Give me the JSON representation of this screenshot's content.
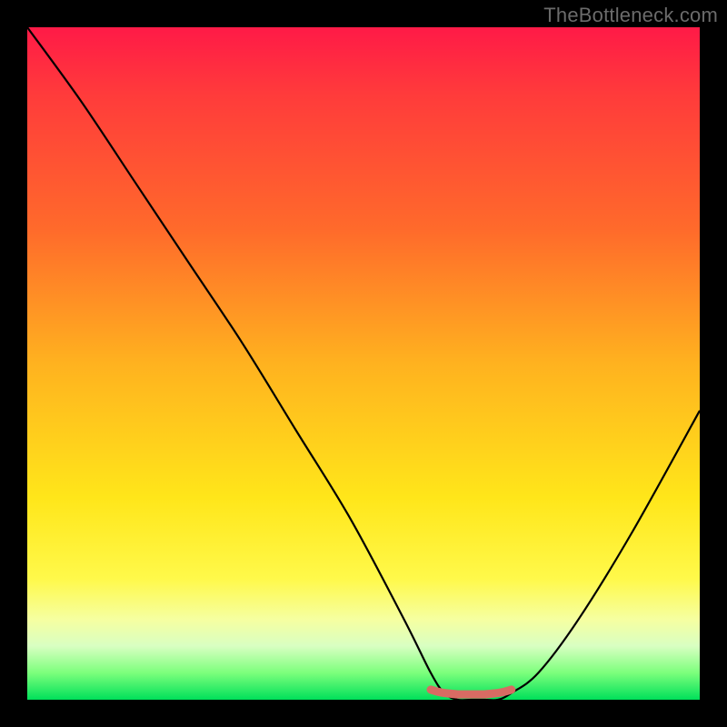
{
  "watermark": "TheBottleneck.com",
  "chart_data": {
    "type": "line",
    "title": "",
    "xlabel": "",
    "ylabel": "",
    "xlim": [
      0,
      100
    ],
    "ylim": [
      0,
      100
    ],
    "series": [
      {
        "name": "bottleneck-curve",
        "x": [
          0,
          8,
          16,
          24,
          32,
          40,
          48,
          56,
          60,
          62,
          64,
          66,
          68,
          70,
          72,
          76,
          82,
          90,
          100
        ],
        "values": [
          100,
          89,
          77,
          65,
          53,
          40,
          27,
          12,
          4,
          1,
          0,
          0,
          0,
          0,
          1,
          4,
          12,
          25,
          43
        ]
      },
      {
        "name": "optimal-marker",
        "x": [
          60,
          61,
          62,
          63,
          64,
          65,
          66,
          67,
          68,
          69,
          70,
          71,
          72
        ],
        "values": [
          1.5,
          1.2,
          1.0,
          0.9,
          0.8,
          0.8,
          0.8,
          0.8,
          0.8,
          0.9,
          1.0,
          1.2,
          1.5
        ]
      }
    ],
    "styles": {
      "bottleneck-curve": {
        "stroke": "#000000",
        "width": 2.2,
        "fill": "none"
      },
      "optimal-marker": {
        "stroke": "#d86b63",
        "width": 9,
        "fill": "none",
        "linecap": "round"
      }
    }
  }
}
